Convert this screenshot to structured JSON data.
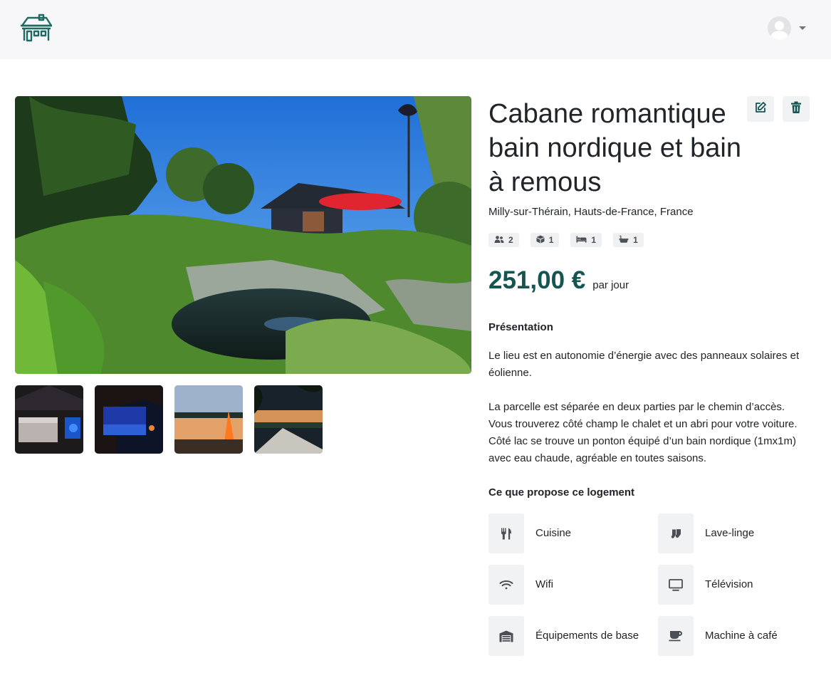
{
  "navbar": {
    "logo_icon": "house-logo-icon",
    "avatar_icon": "user-avatar-icon",
    "dropdown_icon": "caret-down-icon"
  },
  "gallery": {
    "main_photo": "garden-cabin-pond-photo",
    "thumbnails": [
      "cabin-interior-bed",
      "blue-night-window-view",
      "lake-sunset-fire",
      "hammock-lake-sunset"
    ]
  },
  "listing": {
    "title": "Cabane romantique bain nordique et bain à remous",
    "location": "Milly-sur-Thérain, Hauts-de-France, France",
    "badges": [
      {
        "icon": "users-icon",
        "value": "2"
      },
      {
        "icon": "cube-icon",
        "value": "1"
      },
      {
        "icon": "bed-icon",
        "value": "1"
      },
      {
        "icon": "bath-icon",
        "value": "1"
      }
    ],
    "price": "251,00 €",
    "price_unit": "par jour"
  },
  "actions": {
    "edit_icon": "edit-icon",
    "delete_icon": "trash-icon"
  },
  "presentation": {
    "heading": "Présentation",
    "paragraph_1": "Le lieu est en autonomie d’énergie avec des panneaux solaires et éolienne.",
    "paragraph_2": "La parcelle est séparée en deux parties par le chemin d’accès. Vous trouverez côté champ le chalet et un abri pour votre voiture. Côté lac se trouve un ponton équipé d’un bain nordique (1mx1m) avec eau chaude, agréable en toutes saisons."
  },
  "amenities": {
    "heading": "Ce que propose ce logement",
    "items": [
      {
        "icon": "utensils-icon",
        "label": "Cuisine"
      },
      {
        "icon": "socks-icon",
        "label": "Lave-linge"
      },
      {
        "icon": "wifi-icon",
        "label": "Wifi"
      },
      {
        "icon": "tv-icon",
        "label": "Télévision"
      },
      {
        "icon": "warehouse-icon",
        "label": "Équipements de base"
      },
      {
        "icon": "coffee-icon",
        "label": "Machine à café"
      }
    ]
  },
  "colors": {
    "brand": "#145552",
    "navbar_bg": "#f7f7f9",
    "chip_bg": "#f1f2f3"
  }
}
